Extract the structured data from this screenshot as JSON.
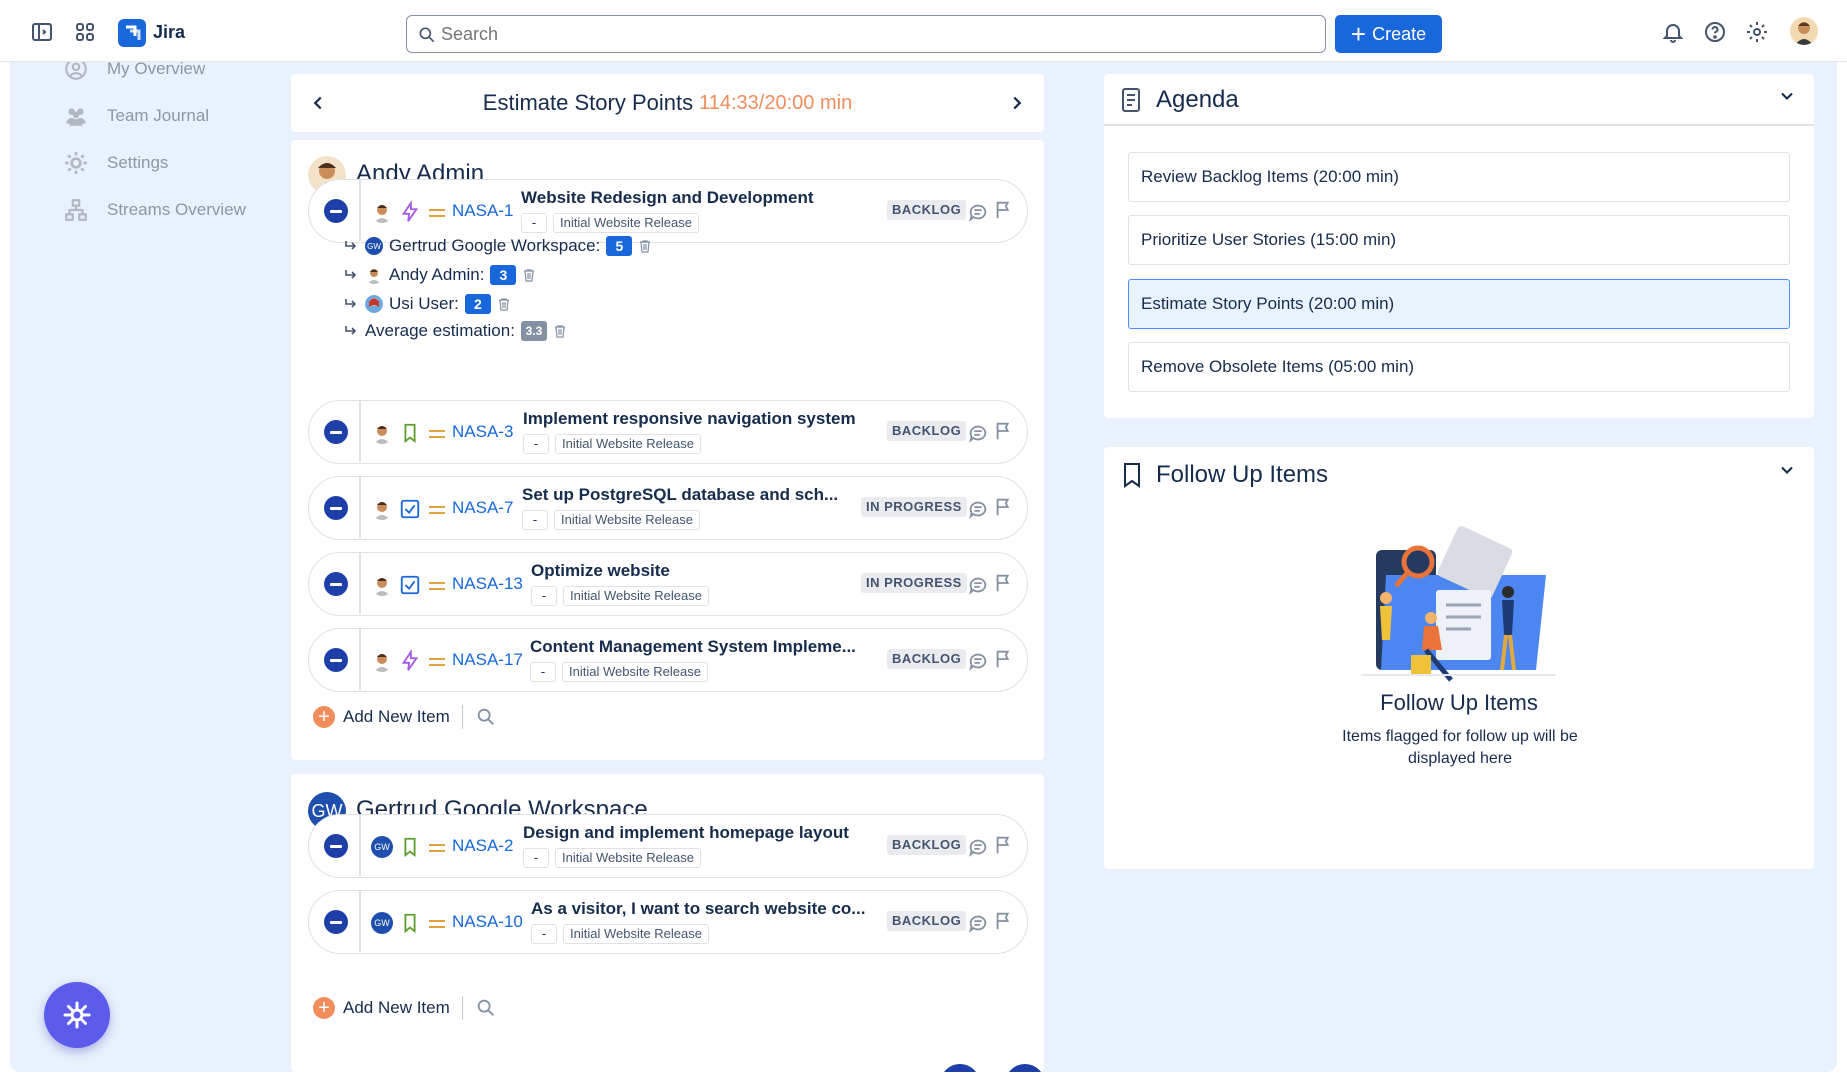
{
  "topbar": {
    "app_name": "Jira",
    "search_placeholder": "Search",
    "create_label": "Create"
  },
  "sidebar": {
    "items": [
      {
        "label": "My Overview",
        "icon": "user-circle-icon"
      },
      {
        "label": "Team Journal",
        "icon": "people-icon"
      },
      {
        "label": "Settings",
        "icon": "gear-icon"
      },
      {
        "label": "Streams Overview",
        "icon": "hierarchy-icon"
      }
    ]
  },
  "session": {
    "title": "Estimate Story Points",
    "timer": "114:33/20:00 min"
  },
  "groups": [
    {
      "name": "Andy Admin",
      "items": [
        {
          "key": "NASA-1",
          "summary": "Website Redesign and Development",
          "type": "epic-lightning-icon",
          "fix": "-",
          "release": "Initial Website Release",
          "status": "BACKLOG"
        },
        {
          "key": "NASA-3",
          "summary": "Implement responsive navigation system",
          "type": "story-bookmark-icon",
          "fix": "-",
          "release": "Initial Website Release",
          "status": "BACKLOG"
        },
        {
          "key": "NASA-7",
          "summary": "Set up PostgreSQL database and sch...",
          "type": "task-check-icon",
          "fix": "-",
          "release": "Initial Website Release",
          "status": "IN PROGRESS"
        },
        {
          "key": "NASA-13",
          "summary": "Optimize website",
          "type": "task-check-icon",
          "fix": "-",
          "release": "Initial Website Release",
          "status": "IN PROGRESS"
        },
        {
          "key": "NASA-17",
          "summary": "Content Management System Impleme...",
          "type": "epic-lightning-icon",
          "fix": "-",
          "release": "Initial Website Release",
          "status": "BACKLOG"
        }
      ],
      "estimates": [
        {
          "name": "Gertrud Google Workspace:",
          "value": "5"
        },
        {
          "name": "Andy Admin:",
          "value": "3"
        },
        {
          "name": "Usi User:",
          "value": "2"
        },
        {
          "name": "Average estimation:",
          "value": "3.3"
        }
      ],
      "add_label": "Add New Item"
    },
    {
      "name": "Gertrud Google Workspace",
      "initials": "GW",
      "items": [
        {
          "key": "NASA-2",
          "summary": "Design and implement homepage layout",
          "type": "story-bookmark-icon",
          "fix": "-",
          "release": "Initial Website Release",
          "status": "BACKLOG"
        },
        {
          "key": "NASA-10",
          "summary": "As a visitor, I want to search website co...",
          "type": "story-bookmark-icon",
          "fix": "-",
          "release": "Initial Website Release",
          "status": "BACKLOG"
        }
      ],
      "add_label": "Add New Item"
    }
  ],
  "agenda": {
    "title": "Agenda",
    "items": [
      "Review Backlog Items (20:00 min)",
      "Prioritize User Stories (15:00 min)",
      "Estimate Story Points (20:00 min)",
      "Remove Obsolete Items (05:00 min)"
    ],
    "active_index": 2
  },
  "follow_up": {
    "title": "Follow Up Items",
    "empty_title": "Follow Up Items",
    "empty_text": "Items flagged for follow up will be displayed here"
  },
  "colors": {
    "accent": "#1868db",
    "timer": "#f18d5c",
    "background": "#e9f1fd",
    "fab": "#5c5cec"
  }
}
